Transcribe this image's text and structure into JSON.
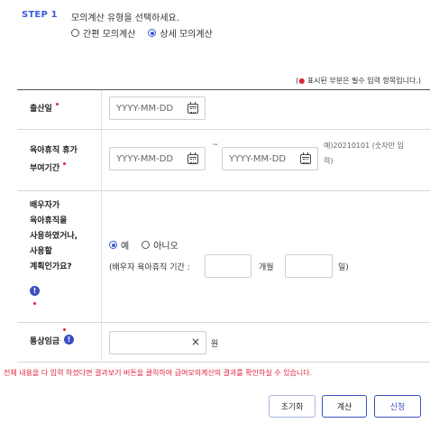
{
  "step": {
    "label": "STEP 1",
    "instruction": "모의계산 유형을 선택하세요.",
    "options": [
      {
        "label": "간편 모의계산",
        "selected": false
      },
      {
        "label": "상세 모의계산",
        "selected": true
      }
    ]
  },
  "required_note": {
    "open": "(",
    "dot": "●",
    "text": " 표시된 부분은 필수 입력 항목입니다.)"
  },
  "fields": {
    "birth": {
      "label": "출산일",
      "placeholder": "YYYY-MM-DD"
    },
    "leave_period": {
      "label_line1": "육아휴직 휴가",
      "label_line2": "부여기간",
      "start_placeholder": "YYYY-MM-DD",
      "separator": "~",
      "end_placeholder": "YYYY-MM-DD",
      "hint_line1": "예)20210101 (숫자만 입",
      "hint_line2": "력)"
    },
    "spouse": {
      "label_lines": [
        "배우자가",
        "육아휴직을",
        "사용하였거나,",
        "사용할",
        "계획인가요?"
      ],
      "info": "!",
      "options": [
        {
          "label": "예",
          "selected": true
        },
        {
          "label": "아니오",
          "selected": false
        }
      ],
      "period_label": "(배우자 육아휴직 기간 :",
      "month_unit": "개월",
      "day_unit": "일)"
    },
    "wage": {
      "label": "통상임금",
      "info": "!",
      "clear": "×",
      "unit": "원"
    }
  },
  "notice": "전체 내용을 다 입력 하셨다면 결과보기 버튼을 클릭하여 급여모의계산의 결과를 확인하실 수 있습니다.",
  "buttons": {
    "reset": "초기화",
    "calculate": "계산",
    "apply": "신청"
  },
  "colors": {
    "accent": "#3a4fc2",
    "required": "#e0243b"
  }
}
